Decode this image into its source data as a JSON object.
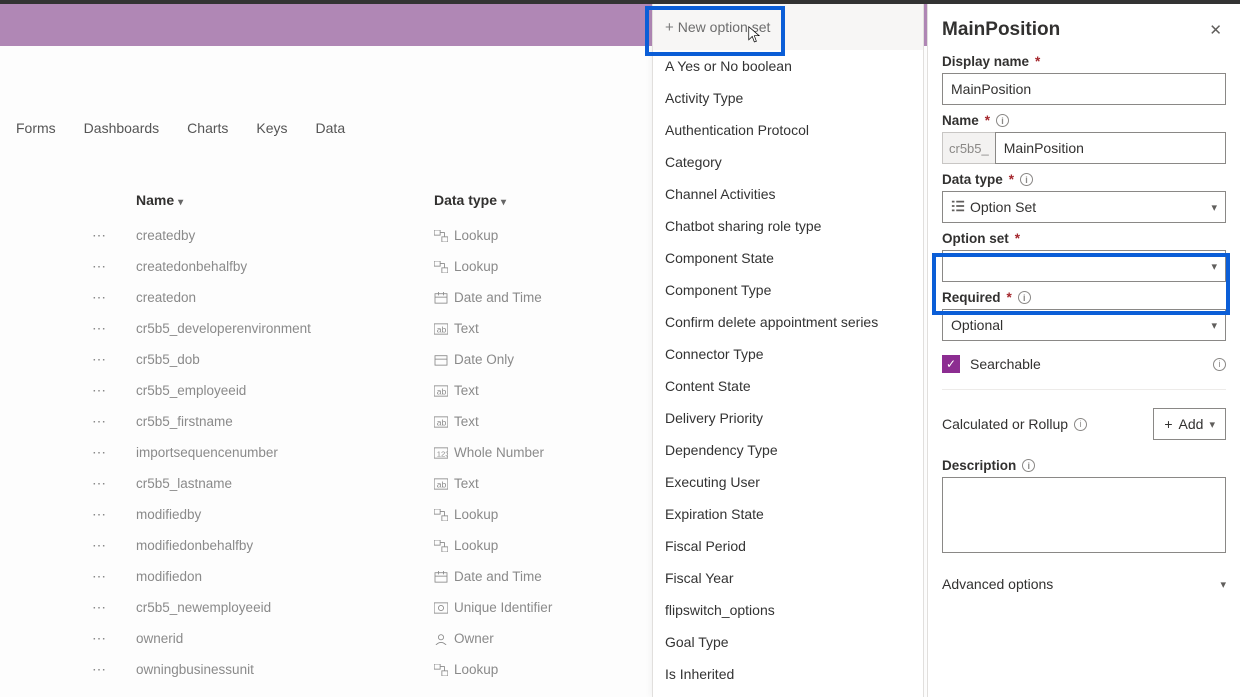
{
  "tabs": {
    "forms": "Forms",
    "dashboards": "Dashboards",
    "charts": "Charts",
    "keys": "Keys",
    "data": "Data"
  },
  "columns": {
    "name": "Name",
    "datatype": "Data type"
  },
  "rows": [
    {
      "name": "createdby",
      "type": "Lookup",
      "icon": "lookup"
    },
    {
      "name": "createdonbehalfby",
      "type": "Lookup",
      "icon": "lookup"
    },
    {
      "name": "createdon",
      "type": "Date and Time",
      "icon": "datetime"
    },
    {
      "name": "cr5b5_developerenvironment",
      "type": "Text",
      "icon": "text"
    },
    {
      "name": "cr5b5_dob",
      "type": "Date Only",
      "icon": "date"
    },
    {
      "name": "cr5b5_employeeid",
      "type": "Text",
      "icon": "text"
    },
    {
      "name": "cr5b5_firstname",
      "type": "Text",
      "icon": "text"
    },
    {
      "name": "importsequencenumber",
      "type": "Whole Number",
      "icon": "number"
    },
    {
      "name": "cr5b5_lastname",
      "type": "Text",
      "icon": "text"
    },
    {
      "name": "modifiedby",
      "type": "Lookup",
      "icon": "lookup"
    },
    {
      "name": "modifiedonbehalfby",
      "type": "Lookup",
      "icon": "lookup"
    },
    {
      "name": "modifiedon",
      "type": "Date and Time",
      "icon": "datetime"
    },
    {
      "name": "cr5b5_newemployeeid",
      "type": "Unique Identifier",
      "icon": "uid"
    },
    {
      "name": "ownerid",
      "type": "Owner",
      "icon": "owner"
    },
    {
      "name": "owningbusinessunit",
      "type": "Lookup",
      "icon": "lookup"
    }
  ],
  "optionlist": {
    "new_label": "New option set",
    "items": [
      "A Yes or No boolean",
      "Activity Type",
      "Authentication Protocol",
      "Category",
      "Channel Activities",
      "Chatbot sharing role type",
      "Component State",
      "Component Type",
      "Confirm delete appointment series",
      "Connector Type",
      "Content State",
      "Delivery Priority",
      "Dependency Type",
      "Executing User",
      "Expiration State",
      "Fiscal Period",
      "Fiscal Year",
      "flipswitch_options",
      "Goal Type",
      "Is Inherited"
    ]
  },
  "panel": {
    "title": "MainPosition",
    "display_name_label": "Display name",
    "display_name_value": "MainPosition",
    "name_label": "Name",
    "name_prefix": "cr5b5_",
    "name_value": "MainPosition",
    "datatype_label": "Data type",
    "datatype_value": "Option Set",
    "optionset_label": "Option set",
    "optionset_value": "",
    "required_label": "Required",
    "required_value": "Optional",
    "searchable_label": "Searchable",
    "calc_label": "Calculated or Rollup",
    "add_label": "Add",
    "description_label": "Description",
    "advanced_label": "Advanced options"
  }
}
